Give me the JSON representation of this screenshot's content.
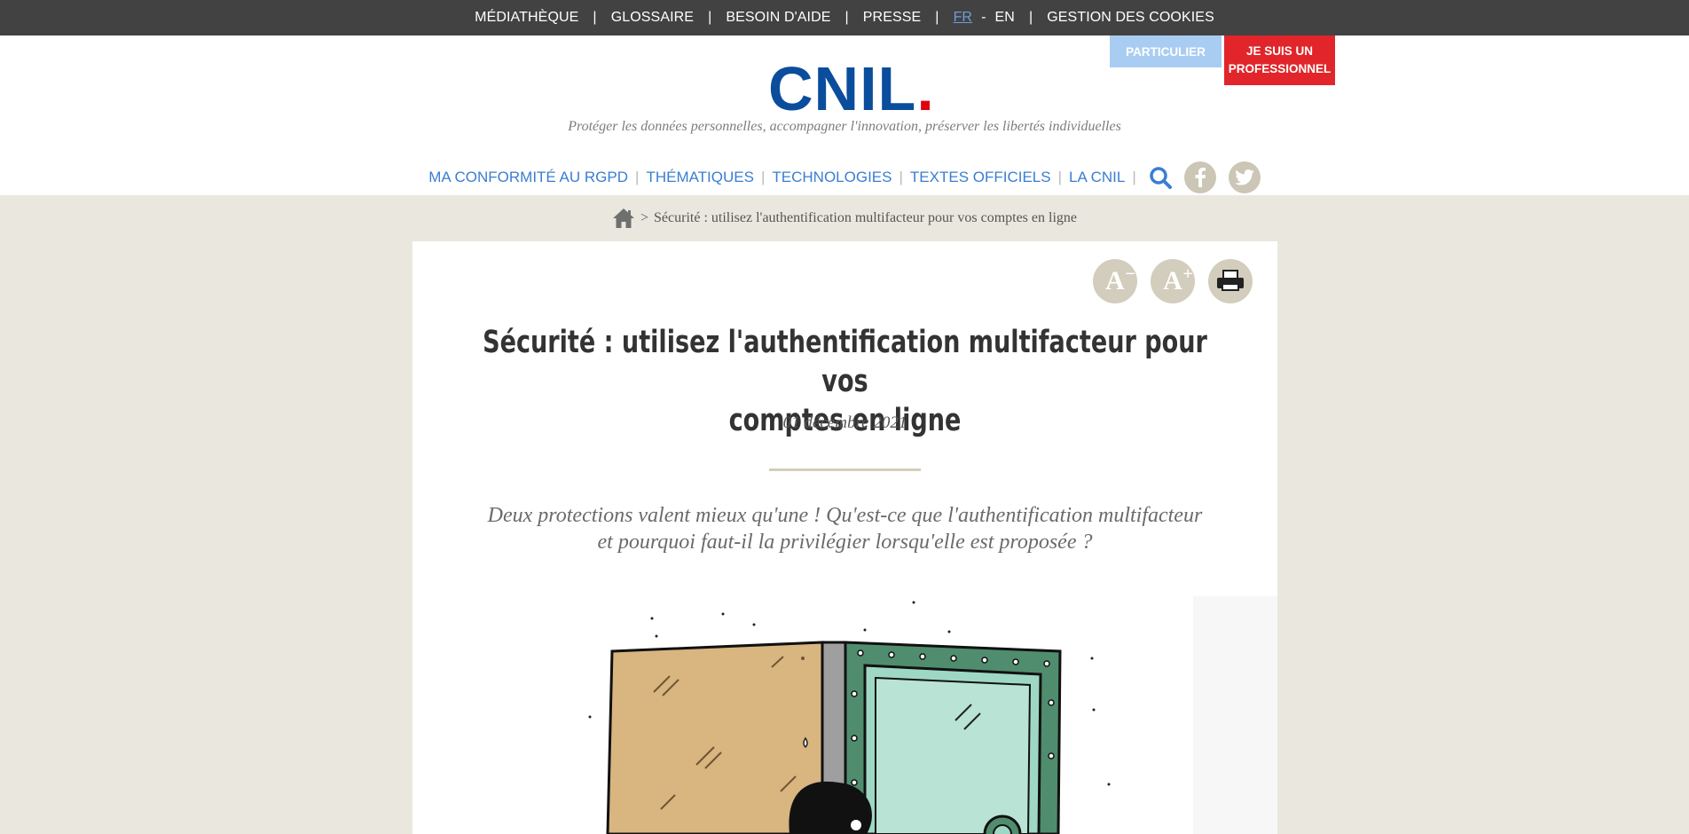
{
  "topbar": {
    "links": [
      "MÉDIATHÈQUE",
      "GLOSSAIRE",
      "BESOIN D'AIDE",
      "PRESSE"
    ],
    "lang_fr": "FR",
    "lang_dash": "-",
    "lang_en": "EN",
    "cookies": "GESTION DES COOKIES",
    "separator": "|"
  },
  "header": {
    "logo_text": "CNIL",
    "logo_dot": ".",
    "tagline": "Protéger les données personnelles, accompagner l'innovation, préserver les libertés individuelles",
    "particulier": "PARTICULIER",
    "pro_line1": "JE SUIS UN",
    "pro_line2": "PROFESSIONNEL"
  },
  "nav": {
    "items": [
      "MA CONFORMITÉ AU RGPD",
      "THÉMATIQUES",
      "TECHNOLOGIES",
      "TEXTES OFFICIELS",
      "LA CNIL"
    ],
    "separator": "|"
  },
  "breadcrumb": {
    "gt": ">",
    "current": "Sécurité : utilisez l'authentification multifacteur pour vos comptes en ligne"
  },
  "article": {
    "tools": {
      "decrease_letter": "A",
      "decrease_mark": "−",
      "increase_letter": "A",
      "increase_mark": "+"
    },
    "title_line1": "Sécurité : utilisez l'authentification multifacteur pour vos",
    "title_line2": "comptes en ligne",
    "date": "01 décembre 2021",
    "intro_line1": "Deux protections valent mieux qu'une ! Qu'est-ce que l'authentification multifacteur",
    "intro_line2": "et pourquoi faut-il la privilégier lorsqu'elle est proposée ?"
  },
  "colors": {
    "topbar_bg": "#424242",
    "page_bg": "#eae8de",
    "brand_blue": "#0b4d9d",
    "brand_red": "#e1000f",
    "nav_blue": "#3b7dd1",
    "pro_red": "#e1252a",
    "particulier_blue": "#a9cdf2",
    "tool_beige": "#d2cdbc"
  },
  "icons": [
    "search-icon",
    "facebook-icon",
    "twitter-icon",
    "home-icon",
    "decrease-font-icon",
    "increase-font-icon",
    "print-icon"
  ]
}
